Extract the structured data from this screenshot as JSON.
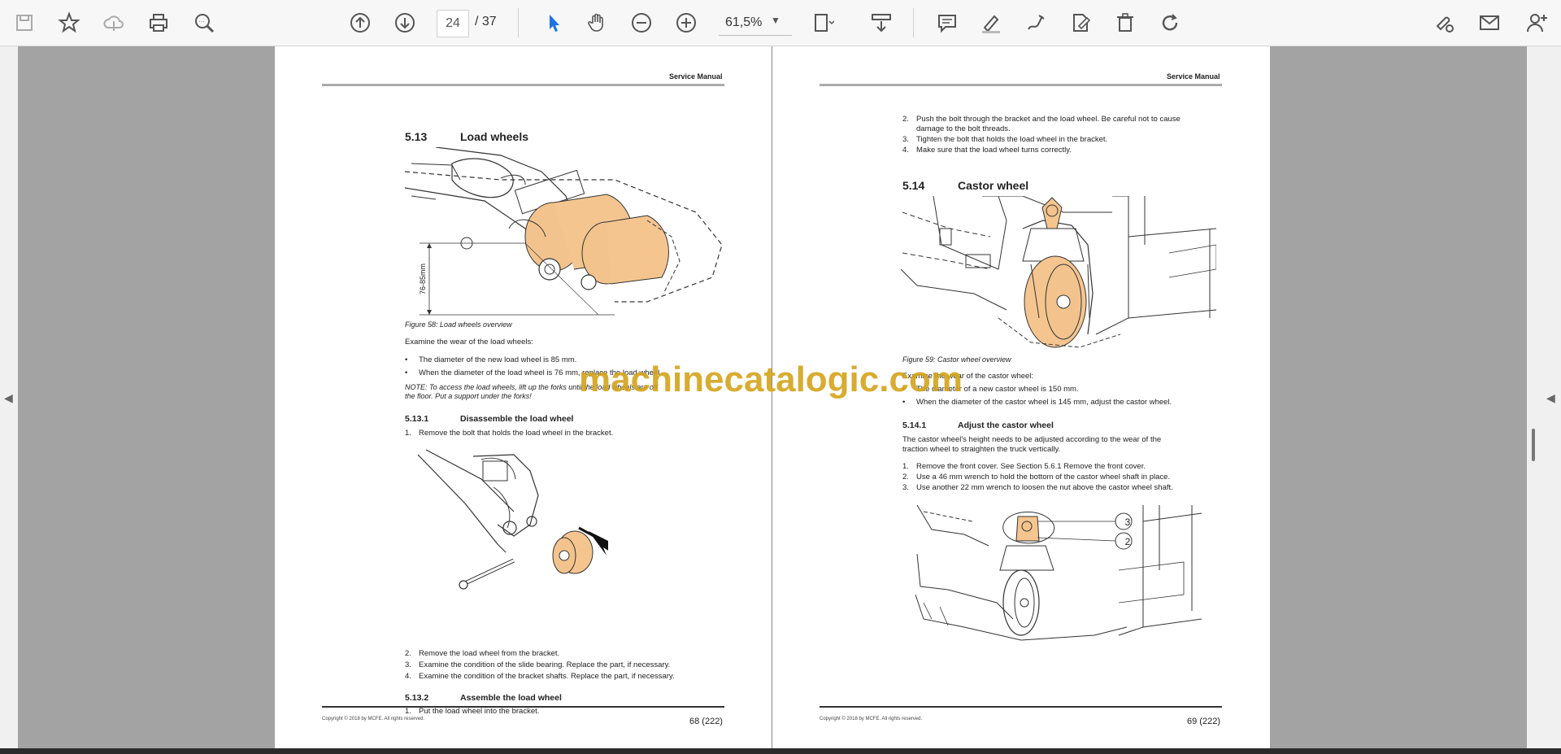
{
  "toolbar": {
    "current_page": "24",
    "total_pages": "/ 37",
    "zoom": "61,5%",
    "icons": [
      "save-icon",
      "bookmark-star-icon",
      "upload-cloud-icon",
      "print-icon",
      "zoom-search-icon",
      "page-up-icon",
      "page-down-icon",
      "select-cursor-icon",
      "hand-pan-icon",
      "zoom-out-icon",
      "zoom-in-icon",
      "fit-page-icon",
      "scroll-mode-icon",
      "comment-icon",
      "highlight-pen-icon",
      "draw-icon",
      "fill-sign-icon",
      "delete-icon",
      "rotate-icon",
      "share-link-icon",
      "email-icon",
      "add-user-icon"
    ]
  },
  "watermark": "machinecatalogic.com",
  "left_page": {
    "header": "Service Manual",
    "section_num": "5.13",
    "section_title": "Load wheels",
    "dimension_label": "76-85mm",
    "figure58_caption": "Figure 58: Load wheels overview",
    "intro": "Examine the wear of the load wheels:",
    "bullets": [
      "The diameter of the new load wheel is 85 mm.",
      "When the diameter of the load wheel is 76 mm, replace the load wheel."
    ],
    "note_line1": "NOTE: To access the load wheels, lift up the forks until the load wheels are off",
    "note_line2": "the floor. Put a support under the forks!",
    "sub1_num": "5.13.1",
    "sub1_title": "Disassemble the load wheel",
    "sub1_steps": [
      {
        "n": "1.",
        "t": "Remove the bolt that holds the load wheel in the bracket."
      }
    ],
    "sub1_steps_after": [
      {
        "n": "2.",
        "t": "Remove the load wheel from the bracket."
      },
      {
        "n": "3.",
        "t": "Examine the condition of the slide bearing. Replace the part, if necessary."
      },
      {
        "n": "4.",
        "t": "Examine the condition of the bracket shafts. Replace the part, if necessary."
      }
    ],
    "sub2_num": "5.13.2",
    "sub2_title": "Assemble the load wheel",
    "sub2_steps": [
      {
        "n": "1.",
        "t": "Put the load wheel into the bracket."
      }
    ],
    "copyright": "Copyright © 2018 by MCFE. All rights reserved.",
    "page_number": "68 (222)"
  },
  "right_page": {
    "header": "Service Manual",
    "top_steps": [
      {
        "n": "2.",
        "t": "Push the bolt through the bracket and the load wheel. Be careful not to cause"
      },
      {
        "n": "",
        "t": "damage to the bolt threads."
      },
      {
        "n": "3.",
        "t": "Tighten the bolt that holds the load wheel in the bracket."
      },
      {
        "n": "4.",
        "t": "Make sure that the load wheel turns correctly."
      }
    ],
    "section_num": "5.14",
    "section_title": "Castor wheel",
    "figure59_caption": "Figure 59: Castor wheel overview",
    "intro": "Examine the wear of the castor wheel:",
    "bullets": [
      "The diameter of a new castor wheel is 150 mm.",
      "When the diameter of the castor wheel is 145 mm, adjust the castor wheel."
    ],
    "sub1_num": "5.14.1",
    "sub1_title": "Adjust the castor wheel",
    "sub1_para_line1": "The castor wheel's height needs to be adjusted according to the wear of the",
    "sub1_para_line2": "traction wheel to straighten the truck vertically.",
    "sub1_steps": [
      {
        "n": "1.",
        "t": "Remove the front cover. See Section 5.6.1 Remove the front cover."
      },
      {
        "n": "2.",
        "t": "Use a 46 mm wrench to hold the bottom of the castor wheel shaft in place."
      },
      {
        "n": "3.",
        "t": "Use another 22 mm wrench to loosen the nut above the castor wheel shaft."
      }
    ],
    "callout_3": "3",
    "callout_2": "2",
    "copyright": "Copyright © 2018 by MCFE. All rights reserved.",
    "page_number": "69 (222)"
  }
}
